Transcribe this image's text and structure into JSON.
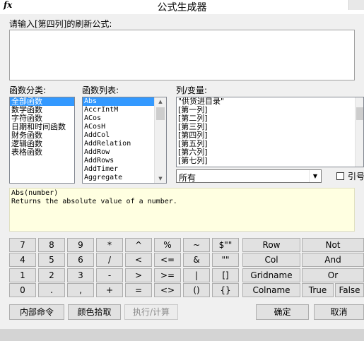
{
  "window": {
    "fx_icon": "fx",
    "title": "公式生成器"
  },
  "formula": {
    "label": "请输入[第四列]的刷新公式:",
    "value": ""
  },
  "categories": {
    "label": "函数分类:",
    "items": [
      "全部函数",
      "数学函数",
      "字符函数",
      "日期和时间函数",
      "财务函数",
      "逻辑函数",
      "表格函数"
    ],
    "selected": 0
  },
  "functions": {
    "label": "函数列表:",
    "items": [
      "Abs",
      "AccrIntM",
      "ACos",
      "ACosH",
      "AddCol",
      "AddRelation",
      "AddRow",
      "AddRows",
      "AddTimer",
      "Aggregate"
    ],
    "selected": 0
  },
  "columns": {
    "label": "列/变量:",
    "items": [
      "\"供货进目录\"",
      "[第一列]",
      "[第二列]",
      "[第三列]",
      "[第四列]",
      "[第五列]",
      "[第六列]",
      "[第七列]"
    ],
    "filter_value": "所有",
    "quote_label": "引号"
  },
  "description": {
    "line1": "Abs(number)",
    "line2": "Returns the absolute value of a number."
  },
  "keypad": {
    "row1": [
      "7",
      "8",
      "9",
      "*",
      "^",
      "%",
      "~",
      "$\"\"",
      "Row",
      "Not"
    ],
    "row2": [
      "4",
      "5",
      "6",
      "/",
      "<",
      "<=",
      "&",
      "\"\"",
      "Col",
      "And"
    ],
    "row3": [
      "1",
      "2",
      "3",
      "-",
      ">",
      ">=",
      "|",
      "[]",
      "Gridname",
      "Or"
    ],
    "row4": [
      "0",
      ".",
      ",",
      "+",
      "=",
      "<>",
      "()",
      "{}",
      "Colname",
      "True",
      "False"
    ]
  },
  "footer": {
    "internal_cmd": "内部命令",
    "color_pick": "颜色拾取",
    "execute": "执行/计算",
    "ok": "确定",
    "cancel": "取消"
  }
}
